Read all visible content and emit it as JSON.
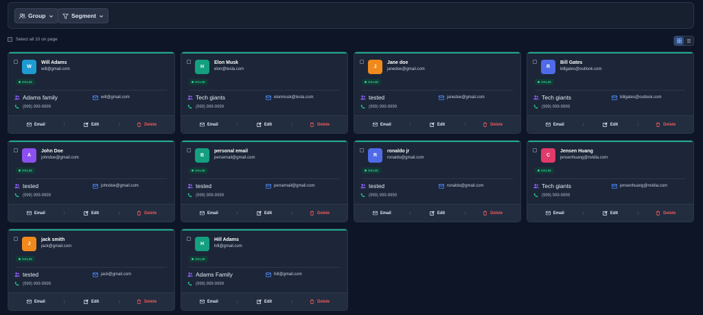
{
  "toolbar": {
    "group_label": "Group",
    "segment_label": "Segment"
  },
  "select_all_label": "Select all 10 on page",
  "actions": {
    "email": "Email",
    "edit": "Edit",
    "delete": "Delete"
  },
  "cards": [
    {
      "initial": "W",
      "name": "Will Adams",
      "email": "will@gmail.com",
      "status": "VALID",
      "group": "Adams family",
      "group_email": "will@gmail.com",
      "phone": "(999) 999-9999",
      "avatar_color": "#1e9bd0"
    },
    {
      "initial": "H",
      "name": "Elon Musk",
      "email": "elon@tesla.com",
      "status": "VALID",
      "group": "Tech giants",
      "group_email": "elonmusk@tesla.com",
      "phone": "(999) 999-9999",
      "avatar_color": "#14a07f"
    },
    {
      "initial": "J",
      "name": "Jane doe",
      "email": "janedoe@gmail.com",
      "status": "VALID",
      "group": "tested",
      "group_email": "janedoe@gmail.com",
      "phone": "(999) 999-9999",
      "avatar_color": "#f08a1c"
    },
    {
      "initial": "R",
      "name": "Bill Gates",
      "email": "billgates@outlook.com",
      "status": "VALID",
      "group": "Tech giants",
      "group_email": "billgates@outlook.com",
      "phone": "(999) 999-9999",
      "avatar_color": "#4f6be8"
    },
    {
      "initial": "A",
      "name": "John Doe",
      "email": "johndoe@gmail.com",
      "status": "VALID",
      "group": "tested",
      "group_email": "johndoe@gmail.com",
      "phone": "(999) 999-9999",
      "avatar_color": "#8c4ff0"
    },
    {
      "initial": "B",
      "name": "personal email",
      "email": "persemail@gmail.com",
      "status": "VALID",
      "group": "tested",
      "group_email": "persemail@gmail.com",
      "phone": "(999) 999-9999",
      "avatar_color": "#14a07f"
    },
    {
      "initial": "R",
      "name": "ronaldo jr",
      "email": "ronaldo@gmail.com",
      "status": "VALID",
      "group": "tested",
      "group_email": "ronaldo@gmail.com",
      "phone": "(999) 999-9999",
      "avatar_color": "#4f6be8"
    },
    {
      "initial": "C",
      "name": "Jensen Huang",
      "email": "jensenhuang@nvidia.com",
      "status": "VALID",
      "group": "Tech giants",
      "group_email": "jensenhuang@nvidia.com",
      "phone": "(999) 999-9999",
      "avatar_color": "#e23a6a"
    },
    {
      "initial": "J",
      "name": "jack smith",
      "email": "jack@gmail.com",
      "status": "VALID",
      "group": "tested",
      "group_email": "jack@gmail.com",
      "phone": "(999) 999-9999",
      "avatar_color": "#f08a1c"
    },
    {
      "initial": "H",
      "name": "Hill Adams",
      "email": "hill@gmail.com",
      "status": "VALID",
      "group": "Adams Family",
      "group_email": "hill@gmail.com",
      "phone": "(999) 999-9999",
      "avatar_color": "#14a07f"
    }
  ]
}
